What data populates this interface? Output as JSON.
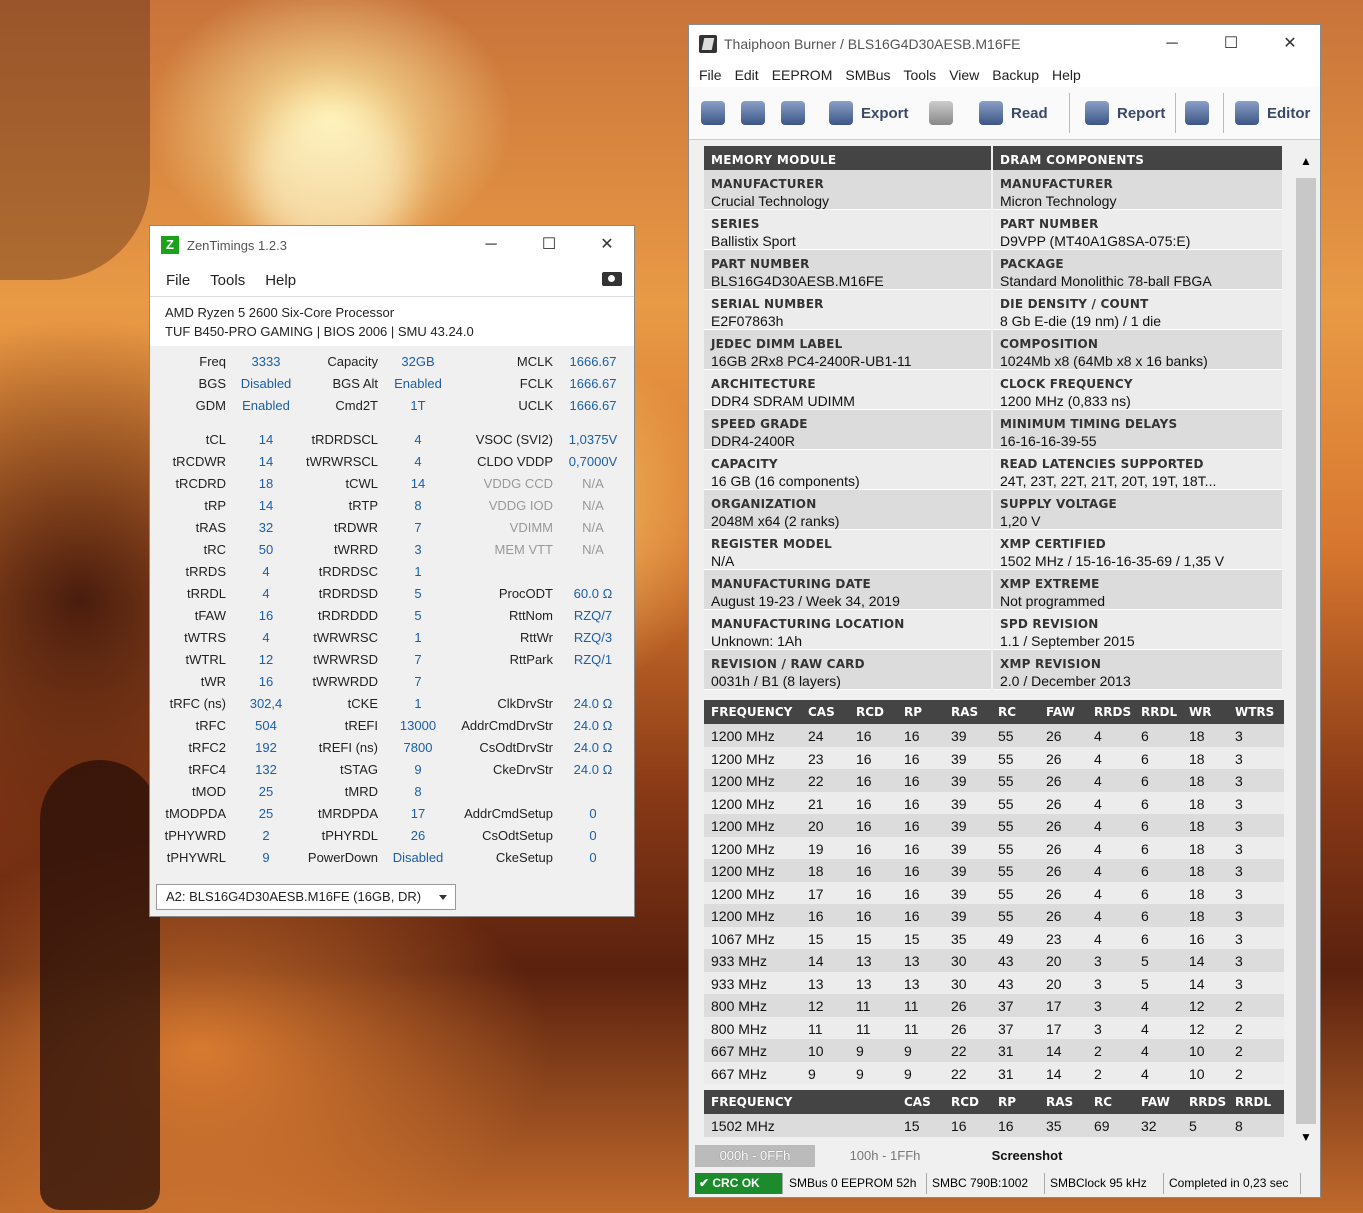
{
  "zentimings": {
    "title": "ZenTimings 1.2.3",
    "logo": "Z",
    "menu": [
      "File",
      "Tools",
      "Help"
    ],
    "cpu": "AMD Ryzen 5 2600 Six-Core Processor",
    "board": "TUF B450-PRO GAMING | BIOS 2006 | SMU 43.24.0",
    "rows": [
      [
        [
          "Freq",
          "3333"
        ],
        [
          "Capacity",
          "32GB"
        ],
        [
          "MCLK",
          "1666.67"
        ]
      ],
      [
        [
          "BGS",
          "Disabled"
        ],
        [
          "BGS Alt",
          "Enabled"
        ],
        [
          "FCLK",
          "1666.67"
        ]
      ],
      [
        [
          "GDM",
          "Enabled"
        ],
        [
          "Cmd2T",
          "1T"
        ],
        [
          "UCLK",
          "1666.67"
        ]
      ],
      null,
      [
        [
          "tCL",
          "14"
        ],
        [
          "tRDRDSCL",
          "4"
        ],
        [
          "VSOC (SVI2)",
          "1,0375V"
        ]
      ],
      [
        [
          "tRCDWR",
          "14"
        ],
        [
          "tWRWRSCL",
          "4"
        ],
        [
          "CLDO VDDP",
          "0,7000V"
        ]
      ],
      [
        [
          "tRCDRD",
          "18"
        ],
        [
          "tCWL",
          "14"
        ],
        [
          "VDDG CCD",
          "N/A"
        ]
      ],
      [
        [
          "tRP",
          "14"
        ],
        [
          "tRTP",
          "8"
        ],
        [
          "VDDG IOD",
          "N/A"
        ]
      ],
      [
        [
          "tRAS",
          "32"
        ],
        [
          "tRDWR",
          "7"
        ],
        [
          "VDIMM",
          "N/A"
        ]
      ],
      [
        [
          "tRC",
          "50"
        ],
        [
          "tWRRD",
          "3"
        ],
        [
          "MEM VTT",
          "N/A"
        ]
      ],
      [
        [
          "tRRDS",
          "4"
        ],
        [
          "tRDRDSC",
          "1"
        ],
        null
      ],
      [
        [
          "tRRDL",
          "4"
        ],
        [
          "tRDRDSD",
          "5"
        ],
        [
          "ProcODT",
          "60.0 Ω"
        ]
      ],
      [
        [
          "tFAW",
          "16"
        ],
        [
          "tRDRDDD",
          "5"
        ],
        [
          "RttNom",
          "RZQ/7"
        ]
      ],
      [
        [
          "tWTRS",
          "4"
        ],
        [
          "tWRWRSC",
          "1"
        ],
        [
          "RttWr",
          "RZQ/3"
        ]
      ],
      [
        [
          "tWTRL",
          "12"
        ],
        [
          "tWRWRSD",
          "7"
        ],
        [
          "RttPark",
          "RZQ/1"
        ]
      ],
      [
        [
          "tWR",
          "16"
        ],
        [
          "tWRWRDD",
          "7"
        ],
        null
      ],
      [
        [
          "tRFC (ns)",
          "302,4"
        ],
        [
          "tCKE",
          "1"
        ],
        [
          "ClkDrvStr",
          "24.0 Ω"
        ]
      ],
      [
        [
          "tRFC",
          "504"
        ],
        [
          "tREFI",
          "13000"
        ],
        [
          "AddrCmdDrvStr",
          "24.0 Ω"
        ]
      ],
      [
        [
          "tRFC2",
          "192"
        ],
        [
          "tREFI (ns)",
          "7800"
        ],
        [
          "CsOdtDrvStr",
          "24.0 Ω"
        ]
      ],
      [
        [
          "tRFC4",
          "132"
        ],
        [
          "tSTAG",
          "9"
        ],
        [
          "CkeDrvStr",
          "24.0 Ω"
        ]
      ],
      [
        [
          "tMOD",
          "25"
        ],
        [
          "tMRD",
          "8"
        ],
        null
      ],
      [
        [
          "tMODPDA",
          "25"
        ],
        [
          "tMRDPDA",
          "17"
        ],
        [
          "AddrCmdSetup",
          "0"
        ]
      ],
      [
        [
          "tPHYWRD",
          "2"
        ],
        [
          "tPHYRDL",
          "26"
        ],
        [
          "CsOdtSetup",
          "0"
        ]
      ],
      [
        [
          "tPHYWRL",
          "9"
        ],
        [
          "PowerDown",
          "Disabled"
        ],
        [
          "CkeSetup",
          "0"
        ]
      ]
    ],
    "dim_labels": [
      "VDDG CCD",
      "VDDG IOD",
      "VDIMM",
      "MEM VTT"
    ],
    "module_select": "A2: BLS16G4D30AESB.M16FE (16GB, DR)"
  },
  "thaiphoon": {
    "title": "Thaiphoon Burner / BLS16G4D30AESB.M16FE",
    "menu": [
      "File",
      "Edit",
      "EEPROM",
      "SMBus",
      "Tools",
      "View",
      "Backup",
      "Help"
    ],
    "toolbar": {
      "export": "Export",
      "read": "Read",
      "report": "Report",
      "editor": "Editor"
    },
    "left_header": "MEMORY MODULE",
    "right_header": "DRAM COMPONENTS",
    "left": [
      [
        "MANUFACTURER",
        "Crucial Technology"
      ],
      [
        "SERIES",
        "Ballistix Sport"
      ],
      [
        "PART NUMBER",
        "BLS16G4D30AESB.M16FE"
      ],
      [
        "SERIAL NUMBER",
        "E2F07863h"
      ],
      [
        "JEDEC DIMM LABEL",
        "16GB 2Rx8 PC4-2400R-UB1-11"
      ],
      [
        "ARCHITECTURE",
        "DDR4 SDRAM UDIMM"
      ],
      [
        "SPEED GRADE",
        "DDR4-2400R"
      ],
      [
        "CAPACITY",
        "16 GB (16 components)"
      ],
      [
        "ORGANIZATION",
        "2048M x64 (2 ranks)"
      ],
      [
        "REGISTER MODEL",
        "N/A"
      ],
      [
        "MANUFACTURING DATE",
        "August 19-23 / Week 34, 2019"
      ],
      [
        "MANUFACTURING LOCATION",
        "Unknown: 1Ah"
      ],
      [
        "REVISION / RAW CARD",
        "0031h / B1 (8 layers)"
      ]
    ],
    "right": [
      [
        "MANUFACTURER",
        "Micron Technology"
      ],
      [
        "PART NUMBER",
        "D9VPP (MT40A1G8SA-075:E)"
      ],
      [
        "PACKAGE",
        "Standard Monolithic 78-ball FBGA"
      ],
      [
        "DIE DENSITY / COUNT",
        "8 Gb E-die (19 nm) / 1 die"
      ],
      [
        "COMPOSITION",
        "1024Mb x8 (64Mb x8 x 16 banks)"
      ],
      [
        "CLOCK FREQUENCY",
        "1200 MHz (0,833 ns)"
      ],
      [
        "MINIMUM TIMING DELAYS",
        "16-16-16-39-55"
      ],
      [
        "READ LATENCIES SUPPORTED",
        "24T, 23T, 22T, 21T, 20T, 19T, 18T..."
      ],
      [
        "SUPPLY VOLTAGE",
        "1,20 V"
      ],
      [
        "XMP CERTIFIED",
        "1502 MHz / 15-16-16-35-69 / 1,35 V"
      ],
      [
        "XMP EXTREME",
        "Not programmed"
      ],
      [
        "SPD REVISION",
        "1.1 / September 2015"
      ],
      [
        "XMP REVISION",
        "2.0 / December 2013"
      ]
    ],
    "freq_headers": [
      "FREQUENCY",
      "CAS",
      "RCD",
      "RP",
      "RAS",
      "RC",
      "FAW",
      "RRDS",
      "RRDL",
      "WR",
      "WTRS"
    ],
    "freq_rows": [
      [
        "1200 MHz",
        "24",
        "16",
        "16",
        "39",
        "55",
        "26",
        "4",
        "6",
        "18",
        "3"
      ],
      [
        "1200 MHz",
        "23",
        "16",
        "16",
        "39",
        "55",
        "26",
        "4",
        "6",
        "18",
        "3"
      ],
      [
        "1200 MHz",
        "22",
        "16",
        "16",
        "39",
        "55",
        "26",
        "4",
        "6",
        "18",
        "3"
      ],
      [
        "1200 MHz",
        "21",
        "16",
        "16",
        "39",
        "55",
        "26",
        "4",
        "6",
        "18",
        "3"
      ],
      [
        "1200 MHz",
        "20",
        "16",
        "16",
        "39",
        "55",
        "26",
        "4",
        "6",
        "18",
        "3"
      ],
      [
        "1200 MHz",
        "19",
        "16",
        "16",
        "39",
        "55",
        "26",
        "4",
        "6",
        "18",
        "3"
      ],
      [
        "1200 MHz",
        "18",
        "16",
        "16",
        "39",
        "55",
        "26",
        "4",
        "6",
        "18",
        "3"
      ],
      [
        "1200 MHz",
        "17",
        "16",
        "16",
        "39",
        "55",
        "26",
        "4",
        "6",
        "18",
        "3"
      ],
      [
        "1200 MHz",
        "16",
        "16",
        "16",
        "39",
        "55",
        "26",
        "4",
        "6",
        "18",
        "3"
      ],
      [
        "1067 MHz",
        "15",
        "15",
        "15",
        "35",
        "49",
        "23",
        "4",
        "6",
        "16",
        "3"
      ],
      [
        "933 MHz",
        "14",
        "13",
        "13",
        "30",
        "43",
        "20",
        "3",
        "5",
        "14",
        "3"
      ],
      [
        "933 MHz",
        "13",
        "13",
        "13",
        "30",
        "43",
        "20",
        "3",
        "5",
        "14",
        "3"
      ],
      [
        "800 MHz",
        "12",
        "11",
        "11",
        "26",
        "37",
        "17",
        "3",
        "4",
        "12",
        "2"
      ],
      [
        "800 MHz",
        "11",
        "11",
        "11",
        "26",
        "37",
        "17",
        "3",
        "4",
        "12",
        "2"
      ],
      [
        "667 MHz",
        "10",
        "9",
        "9",
        "22",
        "31",
        "14",
        "2",
        "4",
        "10",
        "2"
      ],
      [
        "667 MHz",
        "9",
        "9",
        "9",
        "22",
        "31",
        "14",
        "2",
        "4",
        "10",
        "2"
      ]
    ],
    "xmp_headers": [
      "FREQUENCY",
      "CAS",
      "RCD",
      "RP",
      "RAS",
      "RC",
      "FAW",
      "RRDS",
      "RRDL"
    ],
    "xmp_row": [
      "1502 MHz",
      "15",
      "16",
      "16",
      "35",
      "69",
      "32",
      "5",
      "8"
    ],
    "tabs": [
      "000h - 0FFh",
      "100h - 1FFh",
      "Screenshot"
    ],
    "status": [
      "CRC OK",
      "SMBus 0 EEPROM 52h",
      "SMBC 790B:1002",
      "SMBClock 95 kHz",
      "Completed in 0,23 sec"
    ]
  }
}
